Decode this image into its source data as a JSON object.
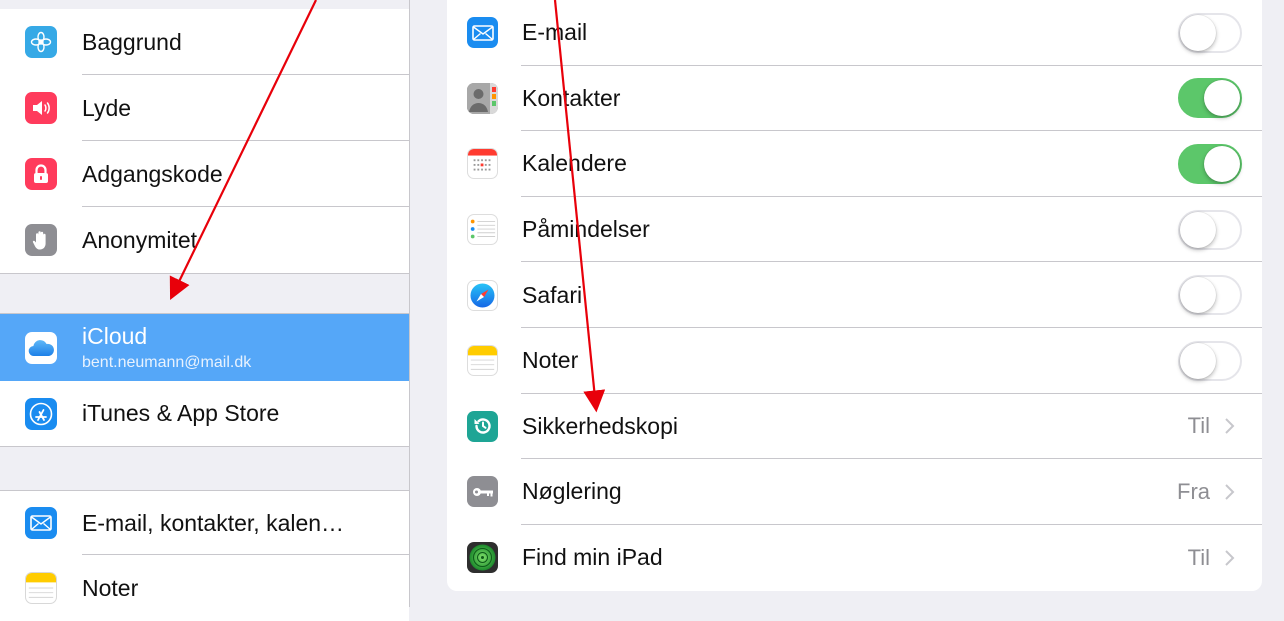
{
  "sidebar": {
    "group1": [
      {
        "label": "Baggrund",
        "icon": "wallpaper-icon",
        "color": "#36a9e6"
      },
      {
        "label": "Lyde",
        "icon": "speaker-icon",
        "color": "#ff3b5c"
      },
      {
        "label": "Adgangskode",
        "icon": "lock-icon",
        "color": "#ff3b5c"
      },
      {
        "label": "Anonymitet",
        "icon": "hand-icon",
        "color": "#8e8e93"
      }
    ],
    "group2": [
      {
        "label": "iCloud",
        "sublabel": "bent.neumann@mail.dk",
        "icon": "icloud-icon",
        "selected": true
      },
      {
        "label": "iTunes & App Store",
        "icon": "app-store-icon",
        "color": "#1a8cf0"
      }
    ],
    "group3": [
      {
        "label": "E-mail, kontakter, kalen…",
        "icon": "mail-icon",
        "color": "#1a8cf0"
      },
      {
        "label": "Noter",
        "icon": "notes-icon",
        "color": "#ffcc00"
      }
    ]
  },
  "detail": {
    "rows": [
      {
        "label": "E-mail",
        "icon": "mail-icon",
        "control": "toggle",
        "on": false
      },
      {
        "label": "Kontakter",
        "icon": "contacts-icon",
        "control": "toggle",
        "on": true
      },
      {
        "label": "Kalendere",
        "icon": "calendar-icon",
        "control": "toggle",
        "on": true
      },
      {
        "label": "Påmindelser",
        "icon": "reminders-icon",
        "control": "toggle",
        "on": false
      },
      {
        "label": "Safari",
        "icon": "safari-icon",
        "control": "toggle",
        "on": false
      },
      {
        "label": "Noter",
        "icon": "notes-icon",
        "control": "toggle",
        "on": false
      },
      {
        "label": "Sikkerhedskopi",
        "icon": "backup-icon",
        "control": "value",
        "value": "Til"
      },
      {
        "label": "Nøglering",
        "icon": "keychain-icon",
        "control": "value",
        "value": "Fra"
      },
      {
        "label": "Find min iPad",
        "icon": "find-my-ipad-icon",
        "control": "value",
        "value": "Til"
      }
    ]
  },
  "colors": {
    "selected": "#55a7f8",
    "toggle_on": "#5cc76a",
    "annotation_arrow": "#e8000a"
  }
}
